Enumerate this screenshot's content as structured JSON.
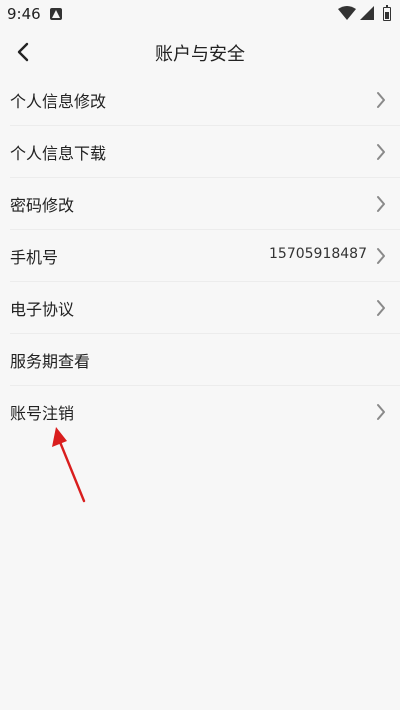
{
  "status_bar": {
    "time": "9:46",
    "notification_icon": "app-notification-icon",
    "wifi_icon": "wifi-icon",
    "signal_icon": "cell-signal-icon",
    "battery_icon": "battery-icon"
  },
  "header": {
    "title": "账户与安全",
    "back_icon": "chevron-left-icon"
  },
  "menu": {
    "items": [
      {
        "label": "个人信息修改",
        "value": "",
        "chevron": true
      },
      {
        "label": "个人信息下载",
        "value": "",
        "chevron": true
      },
      {
        "label": "密码修改",
        "value": "",
        "chevron": true
      },
      {
        "label": "手机号",
        "value": "15705918487",
        "chevron": true
      },
      {
        "label": "电子协议",
        "value": "",
        "chevron": true
      },
      {
        "label": "服务期查看",
        "value": "",
        "chevron": false
      },
      {
        "label": "账号注销",
        "value": "",
        "chevron": true
      }
    ]
  },
  "colors": {
    "background": "#f7f7f7",
    "text": "#222222",
    "chevron": "#8a8a8a",
    "divider": "#ececec",
    "annotation_arrow": "#d91e1e"
  }
}
